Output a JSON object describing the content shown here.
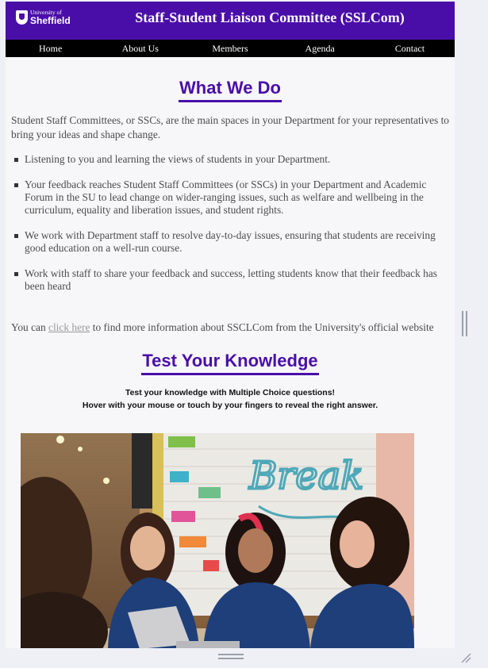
{
  "header": {
    "logo_small": "University of",
    "logo_big": "Sheffield",
    "title": "Staff-Student Liaison Committee (SSLCom)"
  },
  "nav": [
    "Home",
    "About Us",
    "Members",
    "Agenda",
    "Contact"
  ],
  "what_we_do": {
    "heading": "What We Do",
    "intro": "Student Staff Committees, or SSCs, are the main spaces in your Department for your representatives to bring your ideas and shape change.",
    "bullets": [
      "Listening to you and learning the views of students in your Department.",
      "Your feedback reaches Student Staff Committees (or SSCs) in your Department and Academic Forum in the SU to lead change on wider-ranging issues, such as welfare and wellbeing in the curriculum, equality and liberation issues, and student rights.",
      "We work with Department staff to resolve day-to-day issues, ensuring that students are receiving good education on a well-run course.",
      "Work with staff to share your feedback and success, letting students know that their feedback has been heard"
    ],
    "more_prefix": "You can ",
    "more_link": "click here",
    "more_suffix": " to find more information about SSCLCom from the University's official website"
  },
  "knowledge": {
    "heading": "Test Your Knowledge",
    "line1": "Test your knowledge with Multiple Choice questions!",
    "line2": "Hover with your mouse or touch by your fingers to reveal the right answer.",
    "wall_text": "Break"
  },
  "colors": {
    "brand_purple": "#4a0ea8",
    "nav_bg": "#000000",
    "body_text": "#4c4c4c"
  },
  "icons": [
    "university-crest-icon",
    "scrollbar-grip-icon",
    "resize-handle-icon"
  ]
}
